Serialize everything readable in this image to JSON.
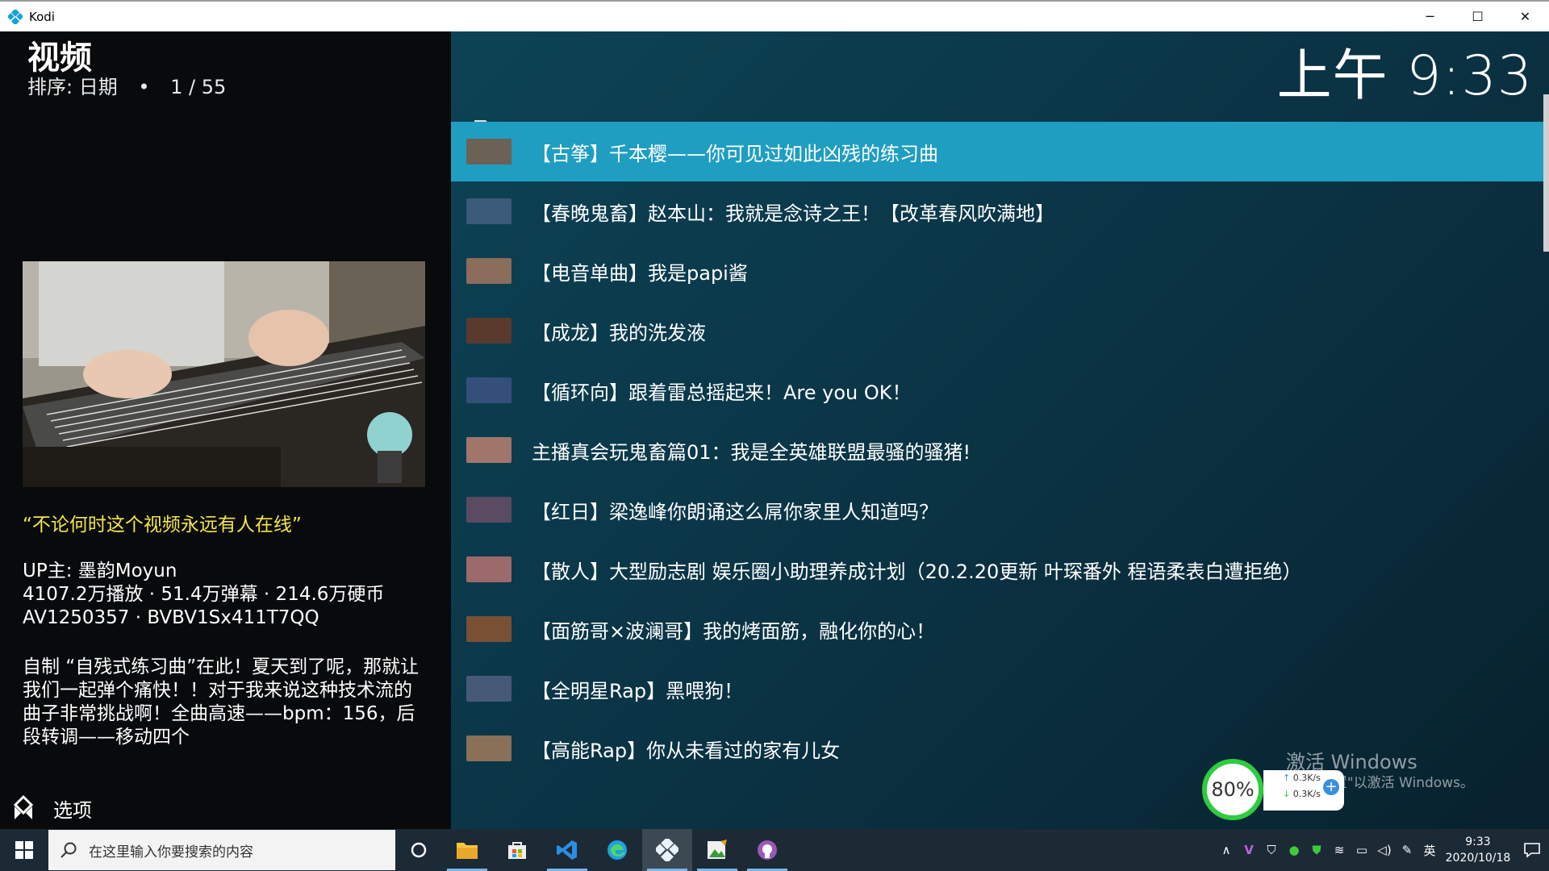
{
  "window": {
    "title": "Kodi",
    "controls": {
      "minimize": "─",
      "maximize": "☐",
      "close": "✕"
    }
  },
  "header": {
    "title": "视频",
    "sort_label": "排序: 日期",
    "bullet": "•",
    "position": "1 / 55"
  },
  "clock": "上午 9:33",
  "parent_item": {
    "label": ".."
  },
  "items": [
    {
      "label": "【古筝】千本樱——你可见过如此凶残的练习曲",
      "thumb": "#6b6154",
      "selected": true
    },
    {
      "label": "【春晚鬼畜】赵本山：我就是念诗之王！【改革春风吹满地】",
      "thumb": "#3c5a7a"
    },
    {
      "label": "【电音单曲】我是papi酱",
      "thumb": "#8a6d5a"
    },
    {
      "label": "【成龙】我的洗发液",
      "thumb": "#5a3a2c"
    },
    {
      "label": "【循环向】跟着雷总摇起来！Are you OK！",
      "thumb": "#34507a"
    },
    {
      "label": "主播真会玩鬼畜篇01：我是全英雄联盟最骚的骚猪!",
      "thumb": "#a0766a"
    },
    {
      "label": "【红日】梁逸峰你朗诵这么屌你家里人知道吗？",
      "thumb": "#5a4a62"
    },
    {
      "label": "【散人】大型励志剧 娱乐圈小助理养成计划（20.2.20更新 叶琛番外 程语柔表白遭拒绝）",
      "thumb": "#9c6a6a"
    },
    {
      "label": "【面筋哥×波澜哥】我的烤面筋，融化你的心！",
      "thumb": "#7a5034"
    },
    {
      "label": "【全明星Rap】黑喂狗！",
      "thumb": "#465a78"
    },
    {
      "label": "【高能Rap】你从未看过的家有儿女",
      "thumb": "#8a7058"
    }
  ],
  "info": {
    "quote": "“不论何时这个视频永远有人在线”",
    "uploader": "UP主: 墨韵Moyun",
    "stats": "4107.2万播放 · 51.4万弹幕 · 214.6万硬币",
    "ids": "AV1250357 · BVBV1Sx411T7QQ",
    "description": "自制 “自残式练习曲”在此！夏天到了呢，那就让我们一起弹个痛快！！对于我来说这种技术流的曲子非常挑战啊！全曲高速——bpm：156，后段转调——移动四个"
  },
  "options_label": "选项",
  "activation": {
    "title": "激活 Windows",
    "subtitle": "转到\"设置\"以激活 Windows。"
  },
  "net_widget": {
    "percent": "80%",
    "up": "0.3K/s",
    "down": "0.3K/s",
    "plus": "+"
  },
  "taskbar": {
    "search_placeholder": "在这里输入你要搜索的内容",
    "ime": "英",
    "time": "9:33",
    "date": "2020/10/18"
  },
  "colors": {
    "selected": "#1f9ec2",
    "quote": "#f5e64a",
    "background": "#0b3b4d"
  }
}
